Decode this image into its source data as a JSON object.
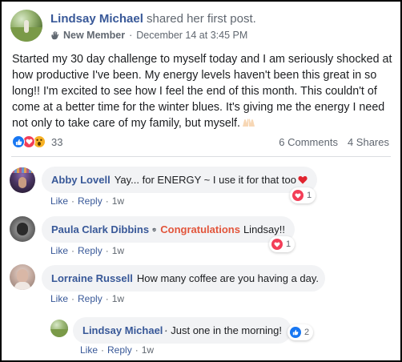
{
  "post": {
    "author": "Lindsay Michael",
    "action": "shared her first post.",
    "badge": "New Member",
    "date": "December 14 at 3:45 PM",
    "text": "Started my 30 day challenge to myself today and I am seriously shocked at how productive I've been. My energy levels haven't been this great in so long!! I'm excited to see how I feel the end of this month. This couldn't of come at a better time for the winter blues. It's giving me the energy I need not only to take care of my family, but myself.",
    "reaction_count": "33",
    "comments_count": "6 Comments",
    "shares_count": "4 Shares",
    "reactions": [
      "like-icon",
      "love-icon",
      "wow-icon"
    ]
  },
  "comments": [
    {
      "name": "Abby Lovell",
      "text": "Yay... for ENERGY ~ I use it for that too",
      "like": "Like",
      "reply": "Reply",
      "time": "1w",
      "reaction_count": "1",
      "reaction": "love-icon"
    },
    {
      "name": "Paula Clark Dibbins",
      "highlight": "Congratulations",
      "text": "Lindsay!!",
      "like": "Like",
      "reply": "Reply",
      "time": "1w",
      "reaction_count": "1",
      "reaction": "love-icon"
    },
    {
      "name": "Lorraine Russell",
      "text": "How many coffee are you having a day.",
      "like": "Like",
      "reply": "Reply",
      "time": "1w"
    }
  ],
  "reply": {
    "name": "Lindsay Michael",
    "text": "Just one in the morning!",
    "like": "Like",
    "reply": "Reply",
    "time": "1w",
    "reaction_count": "2",
    "reaction": "like-icon"
  },
  "colors": {
    "link": "#385898",
    "meta": "#606770",
    "bubble": "#f2f3f5",
    "like": "#1877f2",
    "love": "#f33e58",
    "wow": "#f7b125",
    "congrats": "#e2553b"
  }
}
